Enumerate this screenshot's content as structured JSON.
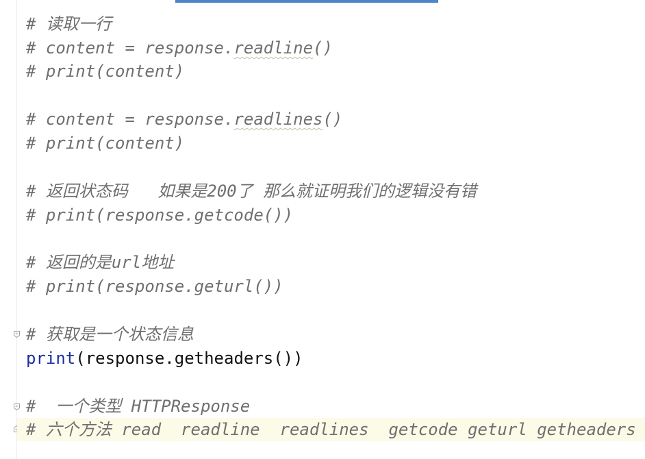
{
  "colors": {
    "tab_indicator": "#4a86c8",
    "comment": "#6f6f6f",
    "code": "#111111",
    "builtin_function": "#1a2fa0",
    "current_line": "#fcfbe8"
  },
  "lines": [
    {
      "text": "# 读取一行",
      "kind": "comment"
    },
    {
      "prefix": "# content = response.",
      "squiggle": "readline",
      "suffix": "()",
      "kind": "comment"
    },
    {
      "text": "# print(content)",
      "kind": "comment"
    },
    {
      "text": "",
      "kind": "blank"
    },
    {
      "prefix": "# content = response.",
      "squiggle": "readlines",
      "suffix": "()",
      "kind": "comment"
    },
    {
      "text": "# print(content)",
      "kind": "comment"
    },
    {
      "text": "",
      "kind": "blank"
    },
    {
      "text": "# 返回状态码   如果是200了 那么就证明我们的逻辑没有错",
      "kind": "comment"
    },
    {
      "text": "# print(response.getcode())",
      "kind": "comment"
    },
    {
      "text": "",
      "kind": "blank"
    },
    {
      "text": "# 返回的是url地址",
      "kind": "comment"
    },
    {
      "text": "# print(response.geturl())",
      "kind": "comment"
    },
    {
      "text": "",
      "kind": "blank"
    },
    {
      "text": "# 获取是一个状态信息",
      "kind": "comment"
    },
    {
      "fn": "print",
      "rest": "(response.getheaders())",
      "kind": "code"
    },
    {
      "text": "",
      "kind": "blank"
    },
    {
      "text": "#  一个类型 HTTPResponse",
      "kind": "comment"
    },
    {
      "text": "# 六个方法 read  readline  readlines  getcode geturl getheaders",
      "kind": "comment"
    }
  ]
}
